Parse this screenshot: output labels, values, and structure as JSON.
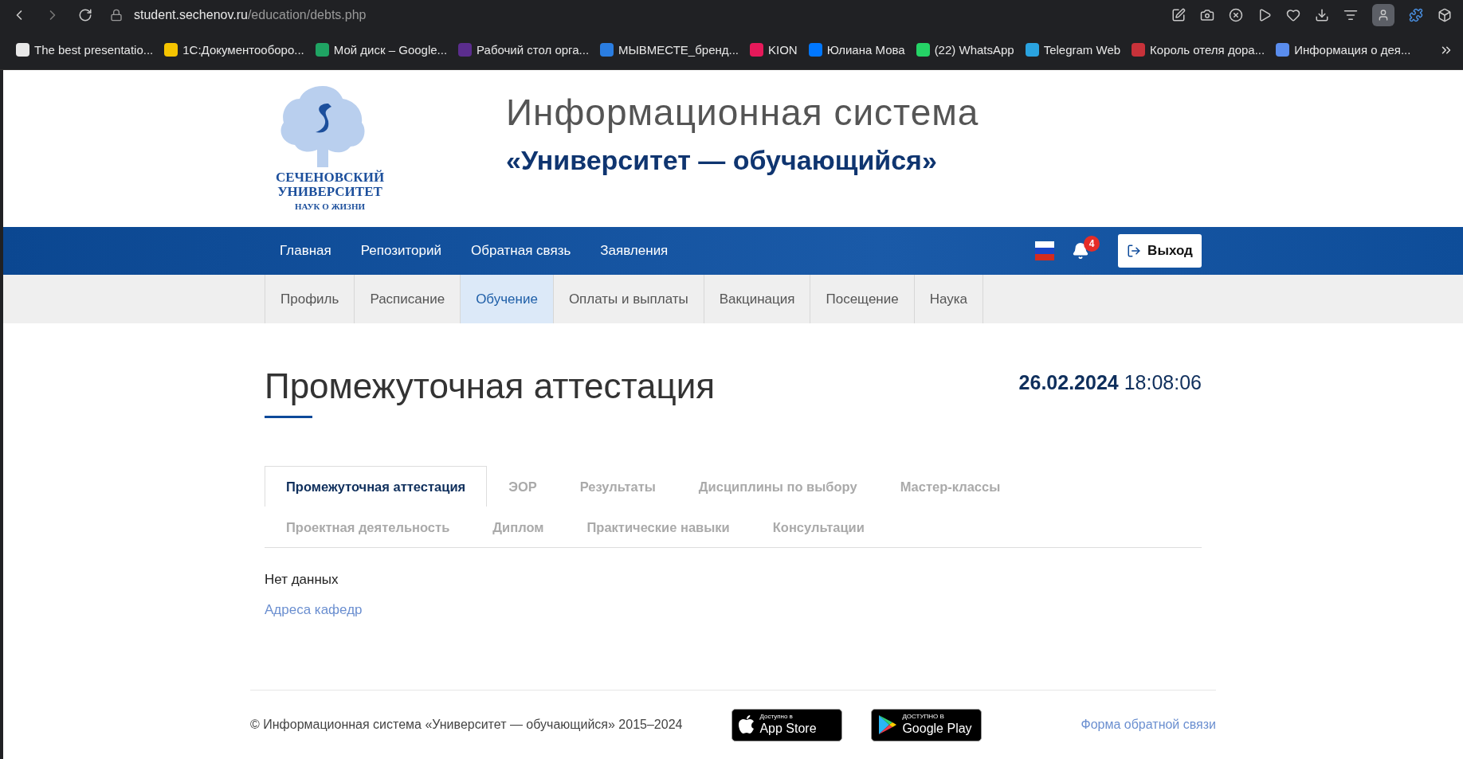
{
  "browser": {
    "address": {
      "host": "student.sechenov.ru",
      "path": "/education/debts.php"
    },
    "bookmarks": [
      {
        "label": "The best presentatio...",
        "color": "#e8e8e8"
      },
      {
        "label": "1С:Документооборо...",
        "color": "#f5c400"
      },
      {
        "label": "Мой диск – Google...",
        "color": "#1fa463"
      },
      {
        "label": "Рабочий стол орга...",
        "color": "#5b2d8e"
      },
      {
        "label": "МЫВМЕСТЕ_бренд...",
        "color": "#2a7de1"
      },
      {
        "label": "KION",
        "color": "#e6195a"
      },
      {
        "label": "Юлиана Мова",
        "color": "#0077ff"
      },
      {
        "label": "(22) WhatsApp",
        "color": "#25d366"
      },
      {
        "label": "Telegram Web",
        "color": "#2aa3e0"
      },
      {
        "label": "Король отеля дора...",
        "color": "#c8323a"
      },
      {
        "label": "Информация о дея...",
        "color": "#5a8dee"
      }
    ]
  },
  "header": {
    "logo": {
      "line_1": "СЕЧЕНОВСКИЙ",
      "line_2": "УНИВЕРСИТЕТ",
      "line_3": "НАУК О ЖИЗНИ"
    },
    "title": "Информационная система",
    "subtitle": "«Университет — обучающийся»"
  },
  "main_nav": {
    "items": [
      "Главная",
      "Репозиторий",
      "Обратная связь",
      "Заявления"
    ],
    "notifications": "4",
    "logout": "Выход"
  },
  "sub_nav": [
    {
      "label": "Профиль",
      "selected": false
    },
    {
      "label": "Расписание",
      "selected": false
    },
    {
      "label": "Обучение",
      "selected": true
    },
    {
      "label": "Оплаты и выплаты",
      "selected": false
    },
    {
      "label": "Вакцинация",
      "selected": false
    },
    {
      "label": "Посещение",
      "selected": false
    },
    {
      "label": "Наука",
      "selected": false
    }
  ],
  "page": {
    "title": "Промежуточная аттестация",
    "date": "26.02.2024",
    "time": "18:08:06"
  },
  "tabs": [
    [
      {
        "label": "Промежуточная аттестация",
        "selected": true
      },
      {
        "label": "ЭОР",
        "selected": false
      },
      {
        "label": "Результаты",
        "selected": false
      },
      {
        "label": "Дисциплины по выбору",
        "selected": false
      },
      {
        "label": "Мастер-классы",
        "selected": false
      }
    ],
    [
      {
        "label": "Проектная деятельность",
        "selected": false
      },
      {
        "label": "Диплом",
        "selected": false
      },
      {
        "label": "Практические навыки",
        "selected": false
      },
      {
        "label": "Консультации",
        "selected": false
      }
    ]
  ],
  "content": {
    "message": "Нет данных",
    "link": "Адреса кафедр"
  },
  "footer": {
    "copyright": "© Информационная система «Университет — обучающийся» 2015–2024",
    "app_store": {
      "small": "Доступно в",
      "big": "App Store"
    },
    "google_play": {
      "small": "ДОСТУПНО В",
      "big": "Google Play"
    },
    "feedback_link": "Форма обратной связи"
  }
}
